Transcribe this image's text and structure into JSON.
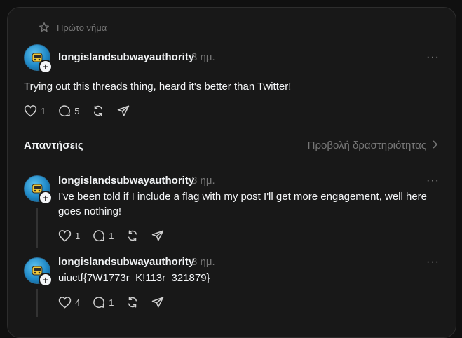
{
  "pinned": {
    "label": "Πρώτο νήμα"
  },
  "main_post": {
    "username": "longislandsubwayauthority",
    "time": "3 ημ.",
    "more": "···",
    "text": "Trying out this threads thing, heard it's better than Twitter!",
    "likes": "1",
    "replies": "5"
  },
  "replies_header": {
    "title": "Απαντήσεις",
    "activity_link": "Προβολή δραστηριότητας"
  },
  "replies": [
    {
      "username": "longislandsubwayauthority",
      "time": "3 ημ.",
      "more": "···",
      "text": "I've been told if I include a flag with my post I'll get more engagement, well here goes nothing!",
      "likes": "1",
      "replies": "1"
    },
    {
      "username": "longislandsubwayauthority",
      "time": "3 ημ.",
      "more": "···",
      "text": "uiuctf{7W1773r_K!113r_321879}",
      "likes": "4",
      "replies": "1"
    }
  ],
  "colors": {
    "background": "#101010",
    "card": "#181818",
    "text": "#f3f5f7",
    "muted": "#777777",
    "avatar": "#1f88c6"
  }
}
